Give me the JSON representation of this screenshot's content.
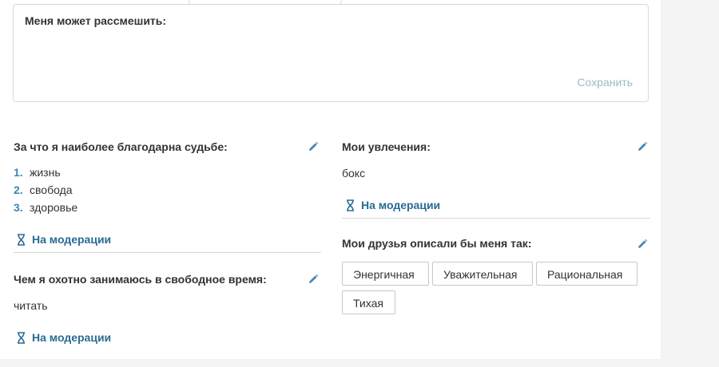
{
  "funny_card": {
    "label": "Меня может рассмешить:",
    "save_label": "Сохранить"
  },
  "grateful": {
    "title": "За что я наиболее благодарна судьбе:",
    "items": [
      {
        "num": "1.",
        "text": "жизнь"
      },
      {
        "num": "2.",
        "text": "свобода"
      },
      {
        "num": "3.",
        "text": "здоровье"
      }
    ],
    "status": "На модерации"
  },
  "free_time": {
    "title": "Чем я охотно занимаюсь в свободное время:",
    "value": "читать",
    "status": "На модерации"
  },
  "hobbies": {
    "title": "Мои увлечения:",
    "value": "бокс",
    "status": "На модерации"
  },
  "friends": {
    "title": "Мои друзья описали бы меня так:",
    "tags": [
      "Энергичная",
      "Уважительная",
      "Рациональная",
      "Тихая"
    ]
  },
  "icons": {
    "edit": "pencil-icon",
    "moderation": "hourglass-icon"
  },
  "colors": {
    "link_blue": "#2a6b93",
    "number_blue": "#3a86b8",
    "save_muted": "#9cbac6",
    "icon_blue": "#4a86b4"
  }
}
